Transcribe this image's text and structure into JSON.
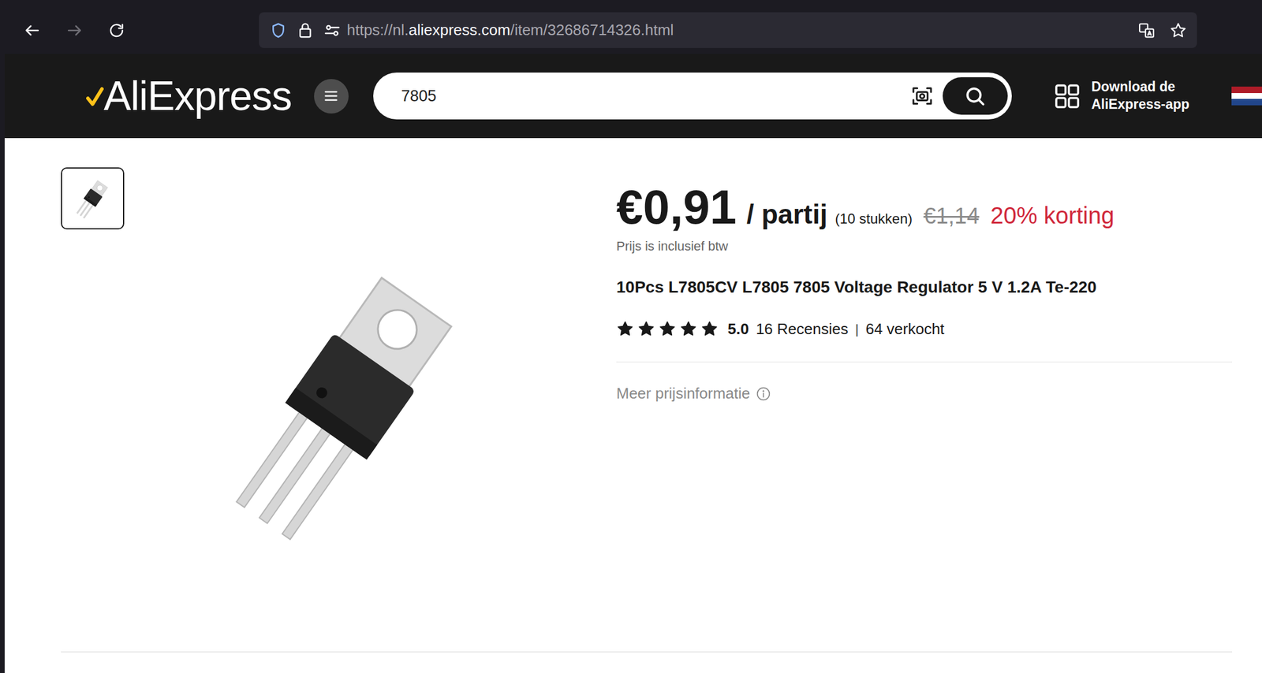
{
  "browser": {
    "back": {
      "enabled": true
    },
    "forward": {
      "enabled": false
    },
    "url_parts": [
      {
        "text": "https://nl.",
        "highlight": false
      },
      {
        "text": "aliexpress.com",
        "highlight": true
      },
      {
        "text": "/item/32686714326.html",
        "highlight": false
      }
    ],
    "bookmarked": false
  },
  "site": {
    "logo": "AliExpress",
    "search": {
      "value": "7805"
    },
    "app_download": [
      "Download de",
      "AliExpress-app"
    ]
  },
  "gallery": {
    "thumbnails": [
      {
        "selected": true
      }
    ]
  },
  "product": {
    "price": "€0,91",
    "unit": "/ partij",
    "quantity": "(10 stukken)",
    "original_price": {
      "text": "€1,14",
      "struck": true
    },
    "discount": "20% korting",
    "tax_note": "Prijs is inclusief btw",
    "title": "10Pcs L7805CV L7805 7805 Voltage Regulator 5 V 1.2A Te-220",
    "rating": {
      "stars": 5,
      "score": "5.0",
      "reviews": "16 Recensies",
      "separator": "|",
      "sold": "64 verkocht"
    },
    "more_info": "Meer prijsinformatie"
  }
}
